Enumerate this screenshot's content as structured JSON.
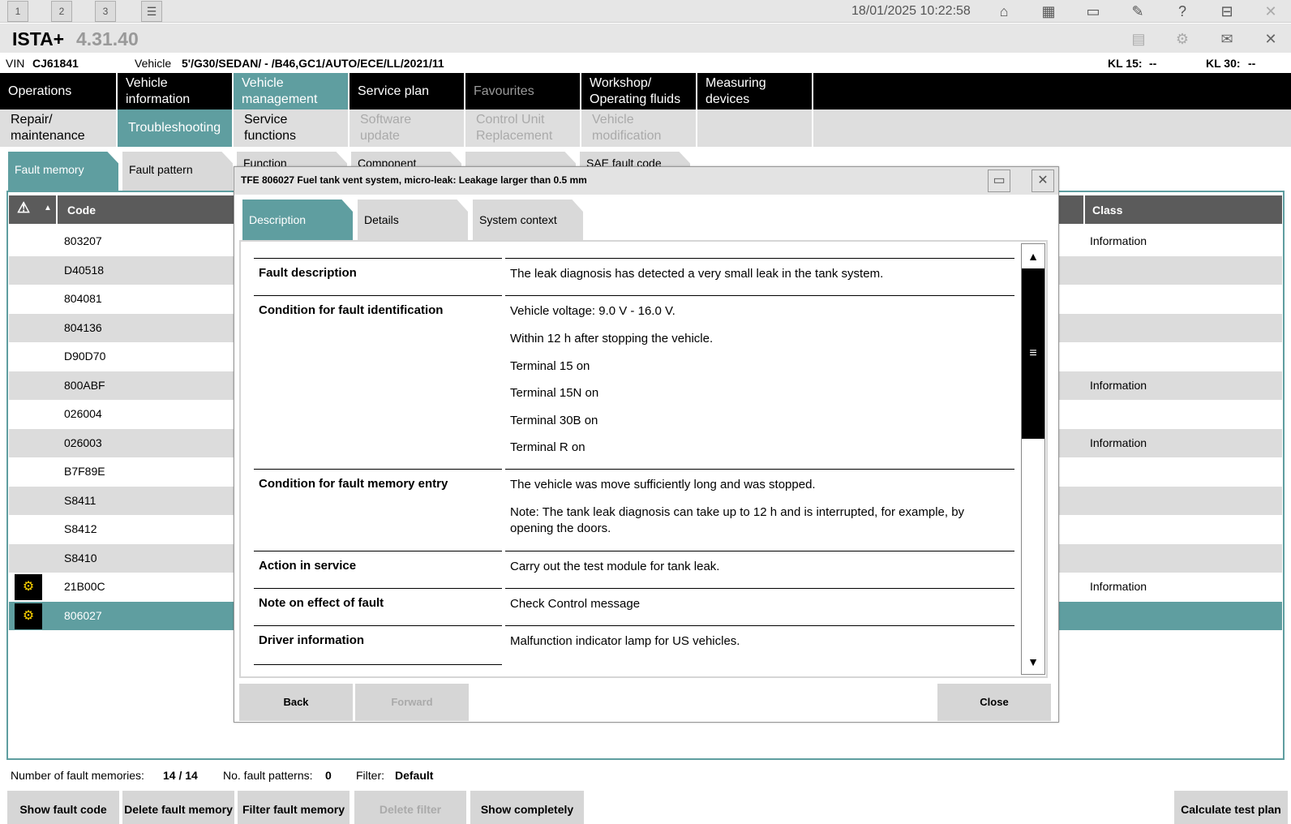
{
  "topbar": {
    "workspaces": [
      "1",
      "2",
      "3"
    ],
    "datetime": "18/01/2025 10:22:58"
  },
  "app": {
    "name": "ISTA+",
    "version": "4.31.40"
  },
  "vehicle": {
    "vin_label": "VIN",
    "vin": "CJ61841",
    "vehicle_label": "Vehicle",
    "vehicle": "5'/G30/SEDAN/ - /B46,GC1/AUTO/ECE/LL/2021/11",
    "kl15_label": "KL 15:",
    "kl15": "--",
    "kl30_label": "KL 30:",
    "kl30": "--"
  },
  "mainmenu": [
    "Operations",
    "Vehicle information",
    "Vehicle management",
    "Service plan",
    "Favourites",
    "Workshop/ Operating fluids",
    "Measuring devices"
  ],
  "submenu": [
    "Repair/ maintenance",
    "Troubleshooting",
    "Service functions",
    "Software update",
    "Control Unit Replacement",
    "Vehicle modification"
  ],
  "tabs": [
    "Fault memory",
    "Fault pattern",
    "Function",
    "Component",
    "",
    "SAE fault code"
  ],
  "table": {
    "headers": {
      "warning": "▲",
      "code": "Code",
      "class": "Class"
    },
    "rows": [
      {
        "code": "803207",
        "class": "Information",
        "icon": ""
      },
      {
        "code": "D40518",
        "class": "",
        "icon": ""
      },
      {
        "code": "804081",
        "class": "",
        "icon": ""
      },
      {
        "code": "804136",
        "class": "",
        "icon": ""
      },
      {
        "code": "D90D70",
        "class": "",
        "icon": ""
      },
      {
        "code": "800ABF",
        "class": "Information",
        "icon": ""
      },
      {
        "code": "026004",
        "class": "",
        "icon": ""
      },
      {
        "code": "026003",
        "class": "Information",
        "icon": ""
      },
      {
        "code": "B7F89E",
        "class": "",
        "icon": ""
      },
      {
        "code": "S8411",
        "class": "",
        "icon": ""
      },
      {
        "code": "S8412",
        "class": "",
        "icon": ""
      },
      {
        "code": "S8410",
        "class": "",
        "icon": ""
      },
      {
        "code": "21B00C",
        "class": "Information",
        "icon": "engine-warning-icon"
      },
      {
        "code": "806027",
        "class": "",
        "icon": "engine-warning-icon"
      }
    ]
  },
  "footer": {
    "count_label": "Number of fault memories:",
    "count": "14 / 14",
    "patterns_label": "No. fault patterns:",
    "patterns": "0",
    "filter_label": "Filter:",
    "filter": "Default",
    "buttons": [
      "Show fault code",
      "Delete fault memory",
      "Filter fault memory",
      "Delete filter",
      "Show completely",
      "Calculate test plan"
    ]
  },
  "dialog": {
    "title": "TFE 806027 Fuel tank vent system, micro-leak: Leakage larger than 0.5 mm",
    "tabs": [
      "Description",
      "Details",
      "System context"
    ],
    "sections": [
      {
        "label": "Fault description",
        "values": [
          "The leak diagnosis has detected a very small leak in the tank system."
        ]
      },
      {
        "label": "Condition for fault identification",
        "values": [
          "Vehicle voltage: 9.0 V - 16.0 V.",
          "Within 12 h after stopping the vehicle.",
          "Terminal 15 on",
          "Terminal 15N on",
          "Terminal 30B on",
          "Terminal R on"
        ]
      },
      {
        "label": "Condition for fault memory entry",
        "values": [
          "The vehicle was move sufficiently long and was stopped.",
          "Note: The tank leak diagnosis can take up to 12 h and is interrupted, for example, by opening the doors."
        ]
      },
      {
        "label": "Action in service",
        "values": [
          "Carry out the test module for tank leak."
        ]
      },
      {
        "label": "Note on effect of fault",
        "values": [
          "Check Control message"
        ]
      },
      {
        "label": "Driver information",
        "values": [
          "Malfunction indicator lamp for US vehicles."
        ]
      }
    ],
    "buttons": {
      "back": "Back",
      "forward": "Forward",
      "close": "Close"
    }
  }
}
